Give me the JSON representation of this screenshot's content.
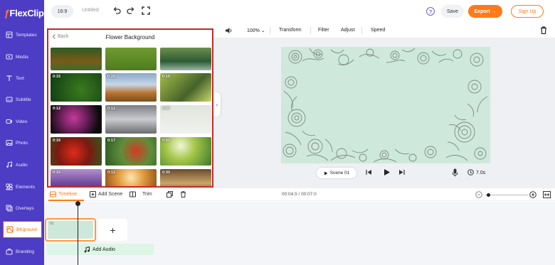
{
  "app": {
    "logo_text": "FlexClip"
  },
  "sidebar": {
    "items": [
      {
        "label": "Templates",
        "icon": "templates-icon"
      },
      {
        "label": "Media",
        "icon": "media-icon"
      },
      {
        "label": "Text",
        "icon": "text-icon"
      },
      {
        "label": "Subtitle",
        "icon": "subtitle-icon"
      },
      {
        "label": "Video",
        "icon": "video-icon"
      },
      {
        "label": "Photo",
        "icon": "photo-icon"
      },
      {
        "label": "Audio",
        "icon": "audio-icon"
      },
      {
        "label": "Elements",
        "icon": "elements-icon"
      },
      {
        "label": "Overlays",
        "icon": "overlays-icon"
      },
      {
        "label": "BKground",
        "icon": "background-icon",
        "active": true
      },
      {
        "label": "Branding",
        "icon": "branding-icon"
      }
    ]
  },
  "topbar": {
    "ratio": "16:9",
    "project_name": "Untitled",
    "save_label": "Save",
    "export_label": "Export →",
    "signup_label": "Sign Up"
  },
  "panel": {
    "back_label": "Back",
    "title": "Flower Background",
    "thumbs": [
      {
        "dur": ""
      },
      {
        "dur": ""
      },
      {
        "dur": ""
      },
      {
        "dur": "0:15"
      },
      {
        "dur": "0:25"
      },
      {
        "dur": "0:16"
      },
      {
        "dur": "0:12"
      },
      {
        "dur": "0:12"
      },
      {
        "dur": "0:07"
      },
      {
        "dur": "0:16"
      },
      {
        "dur": "0:17"
      },
      {
        "dur": "0:50"
      },
      {
        "dur": "0:15"
      },
      {
        "dur": "0:12"
      },
      {
        "dur": "0:30"
      }
    ]
  },
  "editbar": {
    "zoom": "100%",
    "transform": "Transform",
    "filter": "Filter",
    "adjust": "Adjust",
    "speed": "Speed"
  },
  "player": {
    "scene_label": "Scene 01",
    "duration": "7.0s"
  },
  "timeline": {
    "tab_timeline": "Timeline",
    "add_scene": "Add Scene",
    "trim": "Trim",
    "time": "00:04.5 / 00:07.0",
    "clip_number": "01",
    "add_audio": "Add Audio"
  },
  "colors": {
    "sidebar_bg": "#4d3cc4",
    "accent": "#ff7a1a",
    "highlight_border": "#c62828",
    "stage_bg": "#cfe8dc"
  }
}
